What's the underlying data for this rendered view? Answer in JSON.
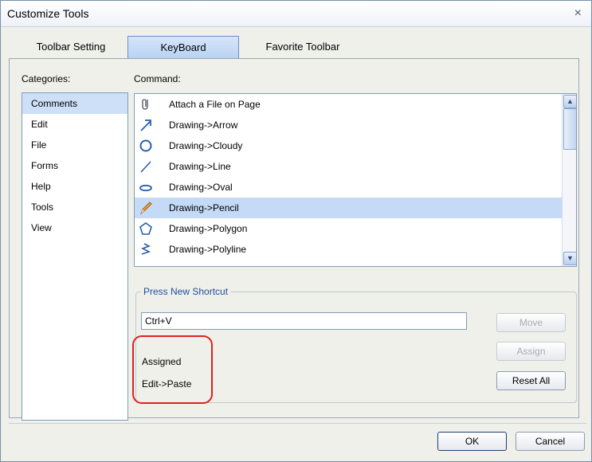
{
  "window": {
    "title": "Customize Tools",
    "close_label": "×"
  },
  "tabs": [
    {
      "label": "Toolbar Setting"
    },
    {
      "label": "KeyBoard"
    },
    {
      "label": "Favorite Toolbar"
    }
  ],
  "categories_label": "Categories:",
  "categories": [
    "Comments",
    "Edit",
    "File",
    "Forms",
    "Help",
    "Tools",
    "View"
  ],
  "selected_category": "Comments",
  "command_label": "Command:",
  "commands": [
    {
      "label": "Attach a File on Page",
      "icon": "paperclip-icon"
    },
    {
      "label": "Drawing->Arrow",
      "icon": "arrow-icon"
    },
    {
      "label": "Drawing->Cloudy",
      "icon": "cloudy-icon"
    },
    {
      "label": "Drawing->Line",
      "icon": "line-icon"
    },
    {
      "label": "Drawing->Oval",
      "icon": "oval-icon"
    },
    {
      "label": "Drawing->Pencil",
      "icon": "pencil-icon"
    },
    {
      "label": "Drawing->Polygon",
      "icon": "polygon-icon"
    },
    {
      "label": "Drawing->Polyline",
      "icon": "polyline-icon"
    }
  ],
  "selected_command": "Drawing->Pencil",
  "shortcut": {
    "group_title": "Press New Shortcut",
    "value": "Ctrl+V",
    "assigned_label": "Assigned",
    "assigned_value": "Edit->Paste"
  },
  "buttons": {
    "move": "Move",
    "assign": "Assign",
    "reset_all": "Reset All",
    "ok": "OK",
    "cancel": "Cancel"
  },
  "colors": {
    "accent": "#1f4fa0",
    "selection": "#c5daf6",
    "highlight_box": "#e02020"
  }
}
